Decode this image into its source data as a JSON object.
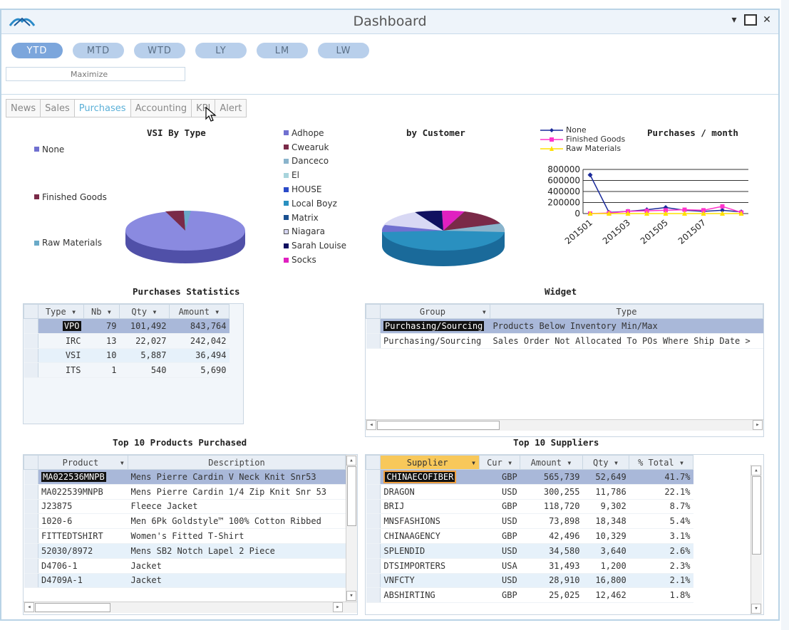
{
  "window": {
    "title": "Dashboard",
    "minimize": "▾",
    "restore": "☐",
    "close": "✕"
  },
  "periods": [
    {
      "label": "YTD",
      "active": true
    },
    {
      "label": "MTD",
      "active": false
    },
    {
      "label": "WTD",
      "active": false
    },
    {
      "label": "LY",
      "active": false
    },
    {
      "label": "LM",
      "active": false
    },
    {
      "label": "LW",
      "active": false
    }
  ],
  "maximize_label": "Maximize",
  "tabs": [
    {
      "label": "News",
      "active": false
    },
    {
      "label": "Sales",
      "active": false
    },
    {
      "label": "Purchases",
      "active": true
    },
    {
      "label": "Accounting",
      "active": false
    },
    {
      "label": "KPI",
      "active": false
    },
    {
      "label": "Alert",
      "active": false
    }
  ],
  "vsi_by_type": {
    "title": "VSI By Type",
    "legend": [
      {
        "label": "None",
        "color": "#7070d0"
      },
      {
        "label": "Finished Goods",
        "color": "#7a2a48"
      },
      {
        "label": "Raw Materials",
        "color": "#6aaac8"
      }
    ]
  },
  "by_customer": {
    "title": "by Customer",
    "legend": [
      {
        "label": "Adhope",
        "color": "#7070d0"
      },
      {
        "label": "Cwearuk",
        "color": "#7a2a48"
      },
      {
        "label": "Danceco",
        "color": "#8ab4cc"
      },
      {
        "label": "El",
        "color": "#a8d4dc"
      },
      {
        "label": "HOUSE",
        "color": "#2a4ac8"
      },
      {
        "label": "Local Boyz",
        "color": "#2a90c0"
      },
      {
        "label": "Matrix",
        "color": "#1a5090"
      },
      {
        "label": "Niagara",
        "color": "#d8d8f4"
      },
      {
        "label": "Sarah Louise",
        "color": "#101060"
      },
      {
        "label": "Socks",
        "color": "#e020c0"
      }
    ]
  },
  "purchases_month": {
    "title": "Purchases / month",
    "legend": [
      {
        "label": "None",
        "color": "#1a2a9a"
      },
      {
        "label": "Finished Goods",
        "color": "#ff33cc"
      },
      {
        "label": "Raw Materials",
        "color": "#ffe000"
      }
    ],
    "y_ticks": [
      "800000",
      "600000",
      "400000",
      "200000",
      "0"
    ],
    "x_ticks": [
      "201501",
      "201503",
      "201505",
      "201507"
    ]
  },
  "chart_data": {
    "type": "line",
    "title": "Purchases / month",
    "x": [
      "201501",
      "201502",
      "201503",
      "201504",
      "201505",
      "201506",
      "201507",
      "201508",
      "201509"
    ],
    "ylim": [
      0,
      800000
    ],
    "series": [
      {
        "name": "None",
        "values": [
          700000,
          20000,
          40000,
          70000,
          110000,
          60000,
          40000,
          60000,
          30000
        ]
      },
      {
        "name": "Finished Goods",
        "values": [
          0,
          10000,
          40000,
          50000,
          60000,
          70000,
          60000,
          130000,
          20000
        ]
      },
      {
        "name": "Raw Materials",
        "values": [
          0,
          0,
          0,
          0,
          0,
          0,
          0,
          0,
          0
        ]
      }
    ]
  },
  "purchases_statistics": {
    "title": "Purchases Statistics",
    "columns": [
      "Type",
      "Nb",
      "Qty",
      "Amount"
    ],
    "rows": [
      [
        "VPO",
        "79",
        "101,492",
        "843,764"
      ],
      [
        "IRC",
        "13",
        "22,027",
        "242,042"
      ],
      [
        "VSI",
        "10",
        "5,887",
        "36,494"
      ],
      [
        "ITS",
        "1",
        "540",
        "5,690"
      ]
    ]
  },
  "widget": {
    "title": "Widget",
    "columns": [
      "Group",
      "Type"
    ],
    "rows": [
      [
        "Purchasing/Sourcing",
        "Products Below Inventory Min/Max"
      ],
      [
        "Purchasing/Sourcing",
        "Sales Order Not Allocated To POs Where Ship Date >"
      ]
    ]
  },
  "top_products": {
    "title": "Top 10 Products Purchased",
    "columns": [
      "Product",
      "Description"
    ],
    "rows": [
      [
        "MA022536MNPB",
        "Mens Pierre Cardin V Neck Knit Snr53"
      ],
      [
        "MA022539MNPB",
        "Mens Pierre Cardin 1/4 Zip Knit Snr 53"
      ],
      [
        "J23875",
        "Fleece Jacket"
      ],
      [
        "1020-6",
        "Men 6Pk Goldstyle™ 100% Cotton Ribbed"
      ],
      [
        "FITTEDTSHIRT",
        "Women's Fitted T-Shirt"
      ],
      [
        "52030/8972",
        "Mens SB2 Notch Lapel 2 Piece"
      ],
      [
        "D4706-1",
        "Jacket"
      ],
      [
        "D4709A-1",
        "Jacket"
      ]
    ]
  },
  "top_suppliers": {
    "title": "Top 10 Suppliers",
    "columns": [
      "Supplier",
      "Cur",
      "Amount",
      "Qty",
      "% Total"
    ],
    "rows": [
      [
        "CHINAECOFIBER",
        "GBP",
        "565,739",
        "52,649",
        "41.7%"
      ],
      [
        "DRAGON",
        "USD",
        "300,255",
        "11,786",
        "22.1%"
      ],
      [
        "BRIJ",
        "GBP",
        "118,720",
        "9,302",
        "8.7%"
      ],
      [
        "MNSFASHIONS",
        "USD",
        "73,898",
        "18,348",
        "5.4%"
      ],
      [
        "CHINAAGENCY",
        "GBP",
        "42,496",
        "10,329",
        "3.1%"
      ],
      [
        "SPLENDID",
        "USD",
        "34,580",
        "3,640",
        "2.6%"
      ],
      [
        "DTSIMPORTERS",
        "USA",
        "31,493",
        "1,200",
        "2.3%"
      ],
      [
        "VNFCTY",
        "USD",
        "28,910",
        "16,800",
        "2.1%"
      ],
      [
        "ABSHIRTING",
        "GBP",
        "25,025",
        "12,462",
        "1.8%"
      ]
    ]
  },
  "icons": [
    "app-logo-icon",
    "minimize-icon",
    "restore-icon",
    "close-icon",
    "mouse-cursor-icon",
    "sort-dropdown-icon",
    "scroll-up-icon",
    "scroll-down-icon",
    "scroll-left-icon",
    "scroll-right-icon"
  ]
}
